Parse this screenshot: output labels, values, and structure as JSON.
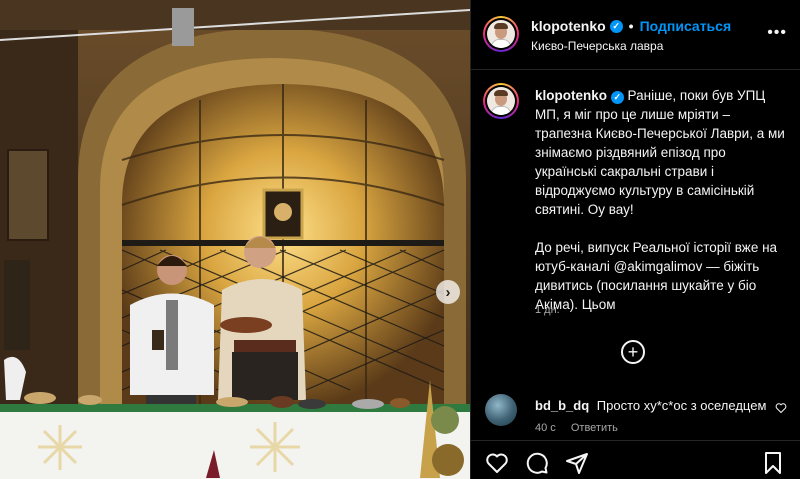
{
  "post": {
    "username": "klopotenko",
    "verified_glyph": "✓",
    "dot": "•",
    "follow_label": "Подписаться",
    "location": "Києво-Печерська лавра",
    "more_glyph": "•••"
  },
  "caption": {
    "username": "klopotenko",
    "paragraph1": "Раніше, поки був УПЦ МП, я міг про це лише мріяти – трапезна Києво-Печерської Лаври, а ми знімаємо різдвяний епізод про українські сакральні страви і відроджуємо культуру в самісінькій святині. Оу вау!",
    "paragraph2": "До речі, випуск Реальної історії вже на ютуб-каналі @akimgalimov — біжіть дивитись (посилання шукайте у біо Акіма). Цьом",
    "time": "1 дн.",
    "plus_glyph": "+"
  },
  "comment": {
    "username": "bd_b_dq",
    "text": "Просто ху*с*ос з оселедцем",
    "time": "40 с",
    "reply_label": "Ответить"
  },
  "icons": {
    "carousel_next": "chevron-right-icon",
    "like": "heart-icon",
    "comment": "comment-icon",
    "share": "send-icon",
    "save": "bookmark-icon"
  },
  "colors": {
    "accent": "#0095f6",
    "background": "#000000",
    "text": "#f5f5f5",
    "muted": "#a8a8a8"
  },
  "carousel_next_glyph": "›"
}
